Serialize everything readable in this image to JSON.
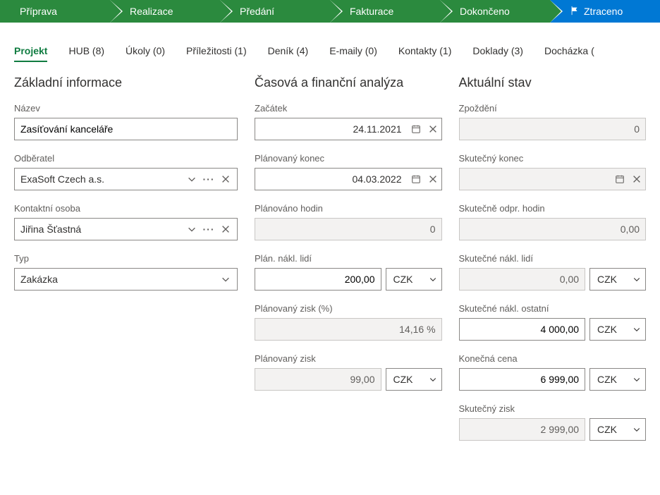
{
  "stages": [
    {
      "label": "Příprava",
      "type": "green"
    },
    {
      "label": "Realizace",
      "type": "green"
    },
    {
      "label": "Předání",
      "type": "green"
    },
    {
      "label": "Fakturace",
      "type": "green"
    },
    {
      "label": "Dokončeno",
      "type": "green"
    },
    {
      "label": "Ztraceno",
      "type": "blue",
      "flag": true
    }
  ],
  "tabs": [
    {
      "label": "Projekt",
      "active": true
    },
    {
      "label": "HUB (8)"
    },
    {
      "label": "Úkoly (0)"
    },
    {
      "label": "Příležitosti (1)"
    },
    {
      "label": "Deník (4)"
    },
    {
      "label": "E-maily (0)"
    },
    {
      "label": "Kontakty (1)"
    },
    {
      "label": "Doklady (3)"
    },
    {
      "label": "Docházka ("
    }
  ],
  "sections": {
    "basic": {
      "title": "Základní informace",
      "name_label": "Název",
      "name_value": "Zasíťování kanceláře",
      "customer_label": "Odběratel",
      "customer_value": "ExaSoft Czech a.s.",
      "contact_label": "Kontaktní osoba",
      "contact_value": "Jiřina Šťastná",
      "type_label": "Typ",
      "type_value": "Zakázka"
    },
    "analysis": {
      "title": "Časová a finanční analýza",
      "start_label": "Začátek",
      "start_value": "24.11.2021",
      "planned_end_label": "Plánovaný konec",
      "planned_end_value": "04.03.2022",
      "planned_hours_label": "Plánováno hodin",
      "planned_hours_value": "0",
      "planned_people_cost_label": "Plán. nákl. lidí",
      "planned_people_cost_value": "200,00",
      "planned_profit_pct_label": "Plánovaný zisk (%)",
      "planned_profit_pct_value": "14,16 %",
      "planned_profit_label": "Plánovaný zisk",
      "planned_profit_value": "99,00"
    },
    "actual": {
      "title": "Aktuální stav",
      "delay_label": "Zpoždění",
      "delay_value": "0",
      "actual_end_label": "Skutečný konec",
      "actual_end_value": "",
      "actual_hours_label": "Skutečně odpr. hodin",
      "actual_hours_value": "0,00",
      "actual_people_cost_label": "Skutečné nákl. lidí",
      "actual_people_cost_value": "0,00",
      "actual_other_cost_label": "Skutečné nákl. ostatní",
      "actual_other_cost_value": "4 000,00",
      "final_price_label": "Konečná cena",
      "final_price_value": "6 999,00",
      "actual_profit_label": "Skutečný zisk",
      "actual_profit_value": "2 999,00"
    }
  },
  "currency": "CZK"
}
